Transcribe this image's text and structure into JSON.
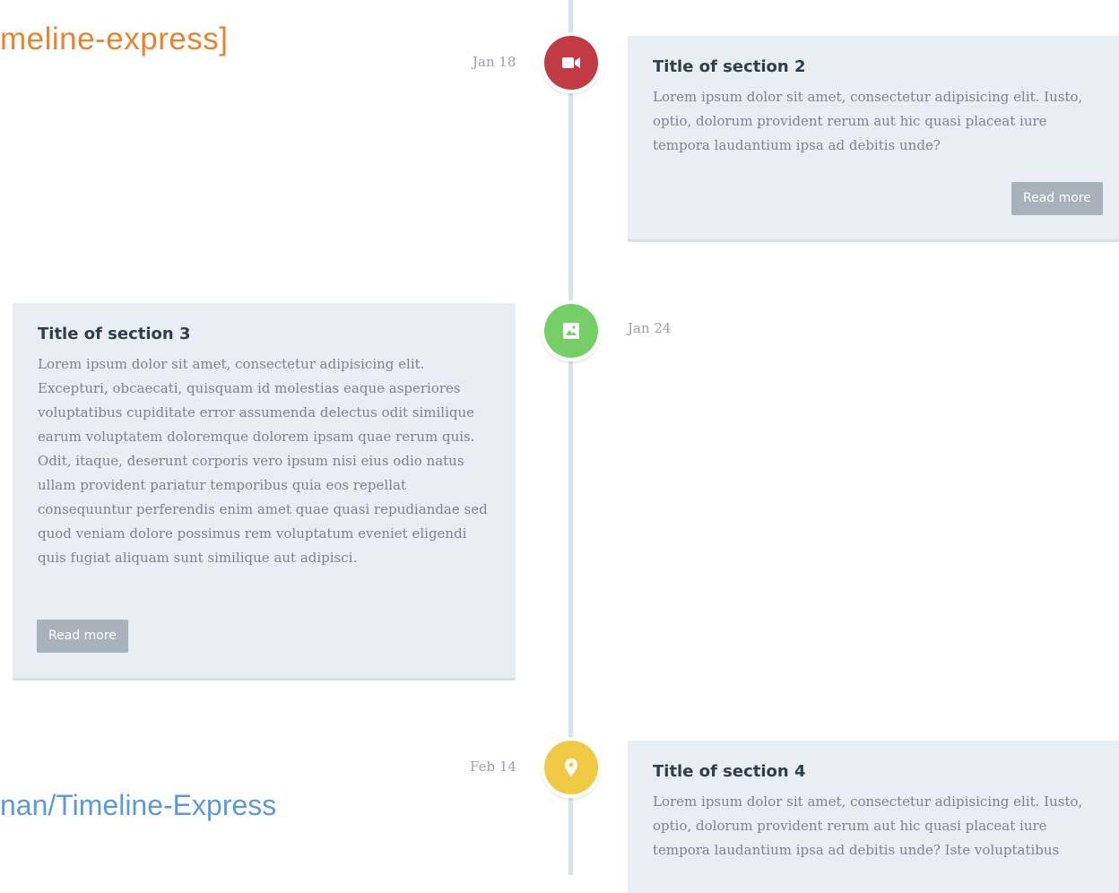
{
  "shortcode_text": "meline-express]",
  "repo_text": "nan/Timeline-Express",
  "colors": {
    "red": "#c03b44",
    "green": "#75ce66",
    "yellow": "#f0ca45",
    "line": "#d7e4ed",
    "card": "#e9eef4"
  },
  "events": [
    {
      "date": "Jan 18",
      "icon": "video-camera-icon",
      "title": "Title of section 2",
      "text": "Lorem ipsum dolor sit amet, consectetur adipisicing elit. Iusto, optio, dolorum provident rerum aut hic quasi placeat iure tempora laudantium ipsa ad debitis unde?",
      "button": "Read more"
    },
    {
      "date": "Jan 24",
      "icon": "image-icon",
      "title": "Title of section 3",
      "text": "Lorem ipsum dolor sit amet, consectetur adipisicing elit. Excepturi, obcaecati, quisquam id molestias eaque asperiores voluptatibus cupiditate error assumenda delectus odit similique earum voluptatem doloremque dolorem ipsam quae rerum quis. Odit, itaque, deserunt corporis vero ipsum nisi eius odio natus ullam provident pariatur temporibus quia eos repellat consequuntur perferendis enim amet quae quasi repudiandae sed quod veniam dolore possimus rem voluptatum eveniet eligendi quis fugiat aliquam sunt similique aut adipisci.",
      "button": "Read more"
    },
    {
      "date": "Feb 14",
      "icon": "location-pin-icon",
      "title": "Title of section 4",
      "text": "Lorem ipsum dolor sit amet, consectetur adipisicing elit. Iusto, optio, dolorum provident rerum aut hic quasi placeat iure tempora laudantium ipsa ad debitis unde? Iste voluptatibus"
    }
  ]
}
